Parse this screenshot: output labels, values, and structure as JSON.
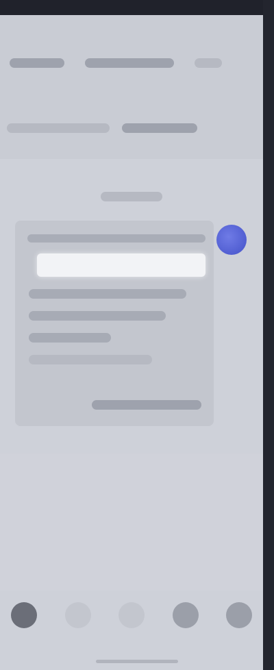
{
  "header": {
    "row1": {
      "items": []
    },
    "row2": {
      "items": []
    },
    "caption": ""
  },
  "card": {
    "title": "",
    "input": {
      "value": "",
      "placeholder": ""
    },
    "lines": [],
    "footer": ""
  },
  "avatar": {
    "color": "#5563d8"
  },
  "bottom_bar": {
    "items": [
      {
        "icon": "left-icon"
      },
      {
        "icon": "tab-icon"
      },
      {
        "icon": "dot-icon"
      },
      {
        "icon": "square-icon"
      },
      {
        "icon": "menu-icon"
      }
    ]
  }
}
